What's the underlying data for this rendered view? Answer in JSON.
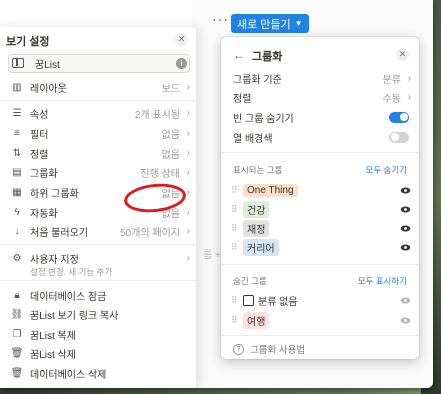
{
  "topbar": {
    "new_button_label": "새로 만들기"
  },
  "background": {
    "ghost_text": "름 +"
  },
  "left_panel": {
    "title": "보기 설정",
    "view_name": "꿈List",
    "layout": {
      "label": "레이아웃",
      "value": "보드"
    },
    "items": [
      {
        "label": "속성",
        "value": "2개 표시됨"
      },
      {
        "label": "필터",
        "value": "없음"
      },
      {
        "label": "정렬",
        "value": "없음"
      },
      {
        "label": "그룹화",
        "value": "진행 상태"
      },
      {
        "label": "하위 그룹화",
        "value": "없음"
      },
      {
        "label": "자동화",
        "value": "없음"
      },
      {
        "label": "처음 불러오기",
        "value": "50개의 페이지"
      }
    ],
    "customize": {
      "label": "사용자 지정",
      "sub": "설정 변경, 새 기능 추가"
    },
    "actions": [
      {
        "label": "데이터베이스 잠금"
      },
      {
        "label": "꿈List 보기 링크 복사"
      },
      {
        "label": "꿈List 복제"
      },
      {
        "label": "꿈List 삭제"
      },
      {
        "label": "데이터베이스 삭제"
      }
    ]
  },
  "right_panel": {
    "title": "그룹화",
    "group_by": {
      "label": "그룹화 기준",
      "value": "분류"
    },
    "sort": {
      "label": "정렬",
      "value": "수동"
    },
    "hide_empty": {
      "label": "빈 그룹 숨기기",
      "on": true
    },
    "col_bg": {
      "label": "열 배경색",
      "on": false
    },
    "visible_section": {
      "label": "표시되는 그룹",
      "action": "모두 숨기기"
    },
    "visible_groups": [
      {
        "label": "One Thing",
        "color": "#fadec9"
      },
      {
        "label": "건강",
        "color": "#dbeddb"
      },
      {
        "label": "재정",
        "color": "#e3e2e0"
      },
      {
        "label": "커리어",
        "color": "#d3e5ef"
      }
    ],
    "hidden_section": {
      "label": "숨긴 그룹",
      "action": "모두 표시하기"
    },
    "hidden_groups": [
      {
        "label": "분류 없음"
      },
      {
        "label": "여행",
        "color": "#ffe2dd"
      }
    ],
    "help": "그룹화 사용법"
  }
}
